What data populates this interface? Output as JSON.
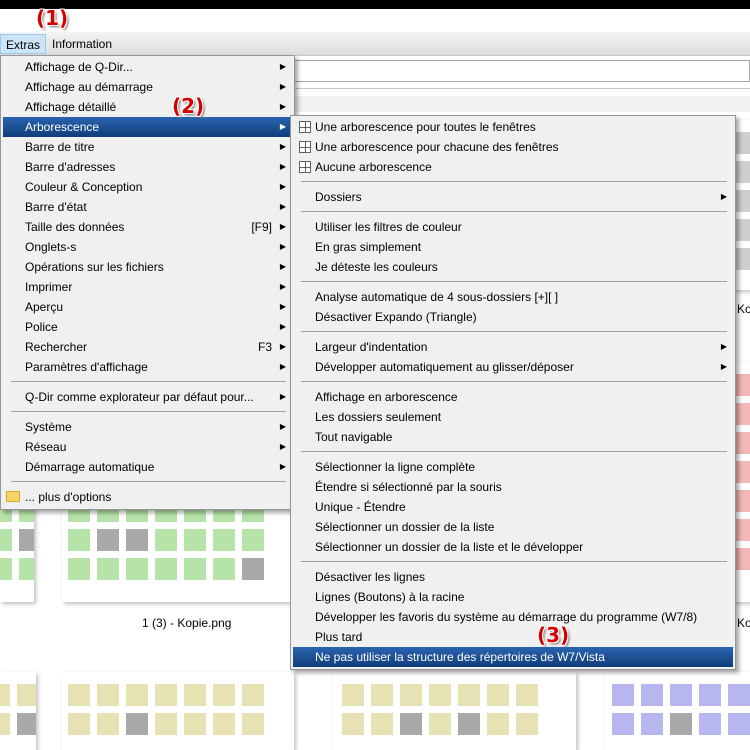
{
  "menubar": {
    "extras": "Extras",
    "information": "Information"
  },
  "callouts": {
    "c1": "(1)",
    "c2": "(2)",
    "c3": "(3)"
  },
  "files": {
    "file1": "1 (3) - Kopie.png",
    "right_partial": "Ko",
    "right_partial2": "Ko"
  },
  "extras_menu": {
    "items": [
      {
        "label": "Affichage de Q-Dir...",
        "arrow": true
      },
      {
        "label": "Affichage au démarrage",
        "arrow": true
      },
      {
        "label": "Affichage détaillé",
        "arrow": true
      },
      {
        "label": "Arborescence",
        "arrow": true,
        "selected": true
      },
      {
        "label": "Barre de titre",
        "arrow": true
      },
      {
        "label": "Barre d'adresses",
        "arrow": true
      },
      {
        "label": "Couleur & Conception",
        "arrow": true
      },
      {
        "label": "Barre d'état",
        "arrow": true
      },
      {
        "label": "Taille des données",
        "shortcut": "[F9]",
        "arrow": true
      },
      {
        "label": "Onglets-s",
        "arrow": true
      },
      {
        "label": "Opérations sur les fichiers",
        "arrow": true
      },
      {
        "label": "Imprimer",
        "arrow": true
      },
      {
        "label": "Aperçu",
        "arrow": true
      },
      {
        "label": "Police",
        "arrow": true
      },
      {
        "label": "Rechercher",
        "shortcut": "F3",
        "arrow": true
      },
      {
        "label": "Paramètres d'affichage",
        "arrow": true
      },
      {
        "label": "Q-Dir comme explorateur par défaut pour...",
        "arrow": true
      },
      {
        "label": "Système",
        "arrow": true
      },
      {
        "label": "Réseau",
        "arrow": true
      },
      {
        "label": "Démarrage automatique",
        "arrow": true
      },
      {
        "label": "... plus d'options",
        "arrow": false
      }
    ]
  },
  "tree_menu": {
    "items": [
      {
        "label": "Une arborescence pour toutes le fenêtres"
      },
      {
        "label": "Une arborescence pour chacune des fenêtres"
      },
      {
        "label": "Aucune arborescence"
      },
      {
        "label": "Dossiers",
        "arrow": true
      },
      {
        "label": "Utiliser les filtres de couleur"
      },
      {
        "label": "En gras simplement"
      },
      {
        "label": "Je déteste les couleurs"
      },
      {
        "label": "Analyse automatique de 4 sous-dossiers [+][ ]"
      },
      {
        "label": "Désactiver Expando (Triangle)"
      },
      {
        "label": "Largeur d'indentation",
        "arrow": true
      },
      {
        "label": "Développer automatiquement au glisser/déposer",
        "arrow": true
      },
      {
        "label": "Affichage en arborescence"
      },
      {
        "label": "Les dossiers seulement"
      },
      {
        "label": "Tout navigable"
      },
      {
        "label": "Sélectionner la ligne complète"
      },
      {
        "label": "Étendre si sélectionné par la souris"
      },
      {
        "label": "Unique - Étendre"
      },
      {
        "label": "Sélectionner un dossier de la liste"
      },
      {
        "label": "Sélectionner un dossier de la liste et le développer"
      },
      {
        "label": "Désactiver les lignes"
      },
      {
        "label": "Lignes (Boutons) à la racine"
      },
      {
        "label": "Développer les favoris du système au démarrage du programme (W7/8)"
      },
      {
        "label": "Plus tard"
      },
      {
        "label": "Ne pas utiliser la structure des répertoires de W7/Vista",
        "selected": true
      }
    ]
  },
  "arrow_glyph": "▶",
  "colors": {
    "green": "#b6e3a8",
    "yellow": "#e7e2b3",
    "red": "#f3b7b7",
    "purple": "#b7b6ee",
    "gray_cell": "#a9a9a9",
    "highlight": "#103d79"
  }
}
